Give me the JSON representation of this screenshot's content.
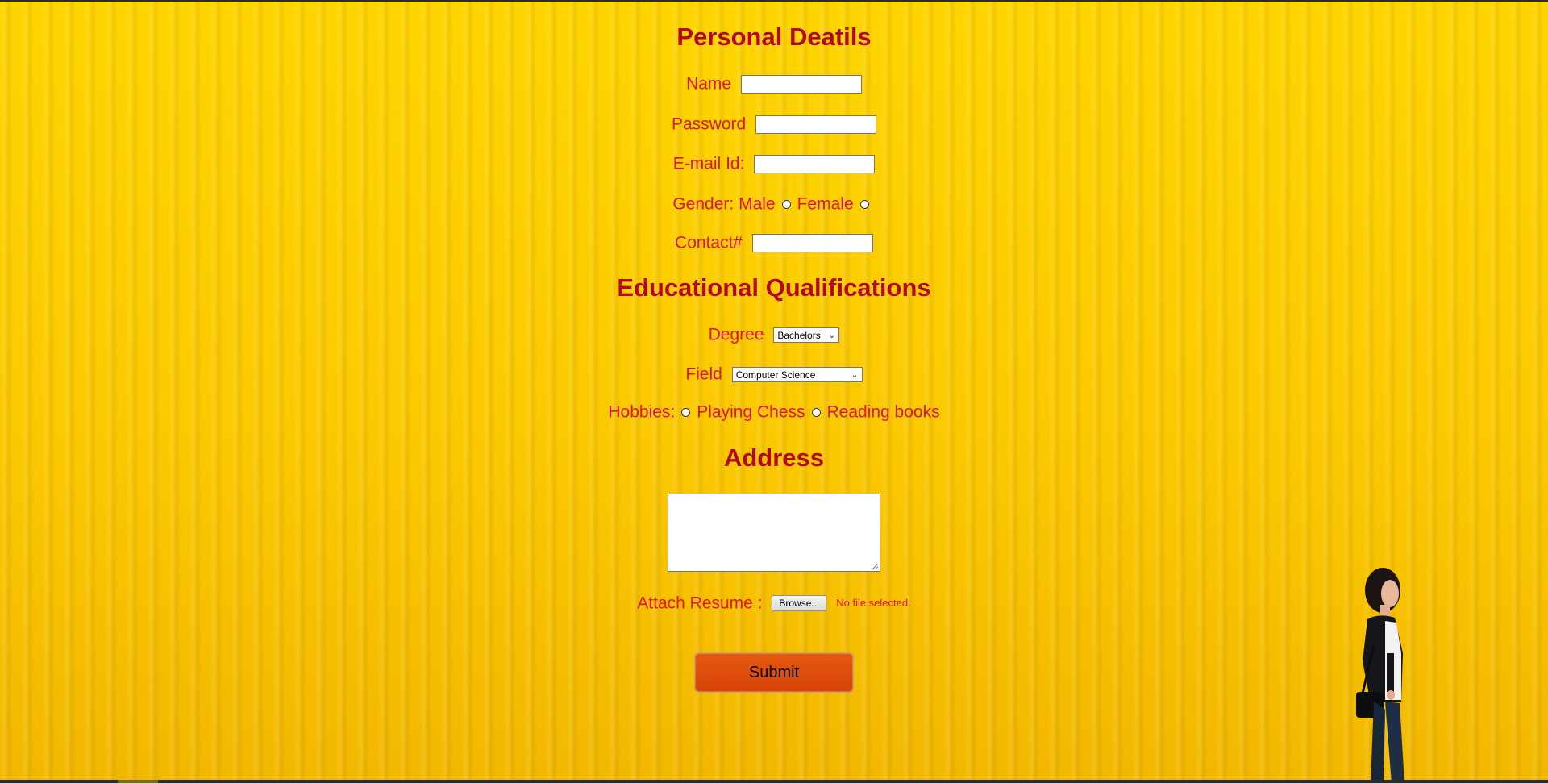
{
  "personal": {
    "heading": "Personal Deatils",
    "name_label": "Name",
    "name_value": "",
    "password_label": "Password",
    "password_value": "",
    "email_label": "E-mail Id:",
    "email_value": "",
    "gender_label": "Gender:",
    "gender_male": "Male",
    "gender_female": "Female",
    "contact_label": "Contact#",
    "contact_value": ""
  },
  "education": {
    "heading": "Educational Qualifications",
    "degree_label": "Degree",
    "degree_selected": "Bachelors",
    "field_label": "Field",
    "field_selected": "Computer Science",
    "hobbies_label": "Hobbies:",
    "hobby_1": "Playing Chess",
    "hobby_2": "Reading books"
  },
  "address": {
    "heading": "Address",
    "value": ""
  },
  "resume": {
    "label": "Attach Resume :",
    "browse_label": "Browse...",
    "status": "No file selected."
  },
  "submit_label": "Submit",
  "colors": {
    "background": "#f7c400",
    "heading": "#b3081e",
    "label": "#e0142c",
    "submit": "#dc4a0a"
  }
}
